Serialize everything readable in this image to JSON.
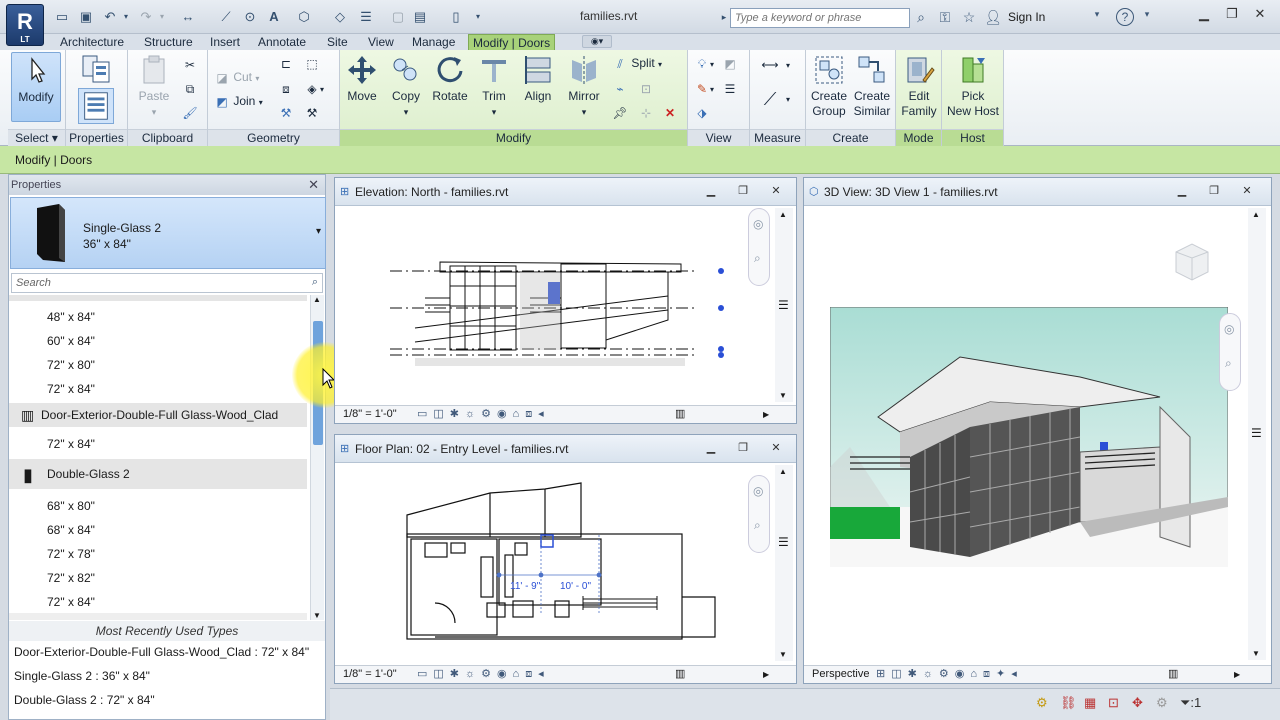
{
  "app": {
    "logo": "R",
    "logo_sub": "LT",
    "doc_title": "families.rvt"
  },
  "title_bar": {
    "search_placeholder": "Type a keyword or phrase",
    "sign_in": "Sign In",
    "help": "?"
  },
  "tabs": [
    "Architecture",
    "Structure",
    "Insert",
    "Annotate",
    "Site",
    "View",
    "Manage",
    "Modify | Doors"
  ],
  "active_tab": "Modify | Doors",
  "ribbon": {
    "select": {
      "button": "Modify",
      "panel": "Select"
    },
    "properties": {
      "panel": "Properties"
    },
    "clipboard": {
      "paste": "Paste",
      "panel": "Clipboard"
    },
    "geometry": {
      "cut": "Cut",
      "join": "Join",
      "panel": "Geometry"
    },
    "modify": {
      "move": "Move",
      "copy": "Copy",
      "rotate": "Rotate",
      "trim": "Trim",
      "align": "Align",
      "mirror": "Mirror",
      "split": "Split",
      "panel": "Modify"
    },
    "view": {
      "panel": "View"
    },
    "measure": {
      "panel": "Measure"
    },
    "create": {
      "create_group_1": "Create",
      "create_group_2": "Group",
      "create_similar_1": "Create",
      "create_similar_2": "Similar",
      "panel": "Create"
    },
    "mode": {
      "edit_family_1": "Edit",
      "edit_family_2": "Family",
      "panel": "Mode"
    },
    "host": {
      "pick_host_1": "Pick",
      "pick_host_2": "New Host",
      "panel": "Host"
    }
  },
  "options_bar": "Modify | Doors",
  "properties": {
    "title": "Properties",
    "type_name": "Single-Glass 2",
    "type_size": "36\" x 84\"",
    "search_placeholder": "Search",
    "list": [
      {
        "label": "48\" x 84\"",
        "kind": "type"
      },
      {
        "label": "60\" x 84\"",
        "kind": "type"
      },
      {
        "label": "72\" x 80\"",
        "kind": "type"
      },
      {
        "label": "72\" x 84\"",
        "kind": "type"
      },
      {
        "label": "Door-Exterior-Double-Full Glass-Wood_Clad",
        "kind": "family"
      },
      {
        "label": "72\" x 84\"",
        "kind": "type"
      },
      {
        "label": "Double-Glass 2",
        "kind": "family"
      },
      {
        "label": "68\" x 80\"",
        "kind": "type"
      },
      {
        "label": "68\" x 84\"",
        "kind": "type"
      },
      {
        "label": "72\" x 78\"",
        "kind": "type"
      },
      {
        "label": "72\" x 82\"",
        "kind": "type"
      },
      {
        "label": "72\" x 84\"",
        "kind": "type"
      }
    ],
    "mru_title": "Most Recently Used Types",
    "mru": [
      "Door-Exterior-Double-Full Glass-Wood_Clad : 72\" x 84\"",
      "Single-Glass 2 : 36\" x 84\"",
      "Double-Glass 2 : 72\" x 84\""
    ]
  },
  "views": {
    "elevation": {
      "title": "Elevation: North - families.rvt",
      "scale": "1/8\" = 1'-0\""
    },
    "floorplan": {
      "title": "Floor Plan: 02 - Entry Level - families.rvt",
      "scale": "1/8\" = 1'-0\"",
      "dim1": "11' - 9\"",
      "dim2": "10' - 0\""
    },
    "view3d": {
      "title": "3D View: 3D View 1 - families.rvt",
      "mode": "Perspective"
    }
  },
  "statusbar": {
    "filter_count": ":1"
  },
  "colors": {
    "accent_green": "#a8d27a",
    "ribbon_blue": "#b5d2f3",
    "selection_blue": "#2a4fd6"
  }
}
